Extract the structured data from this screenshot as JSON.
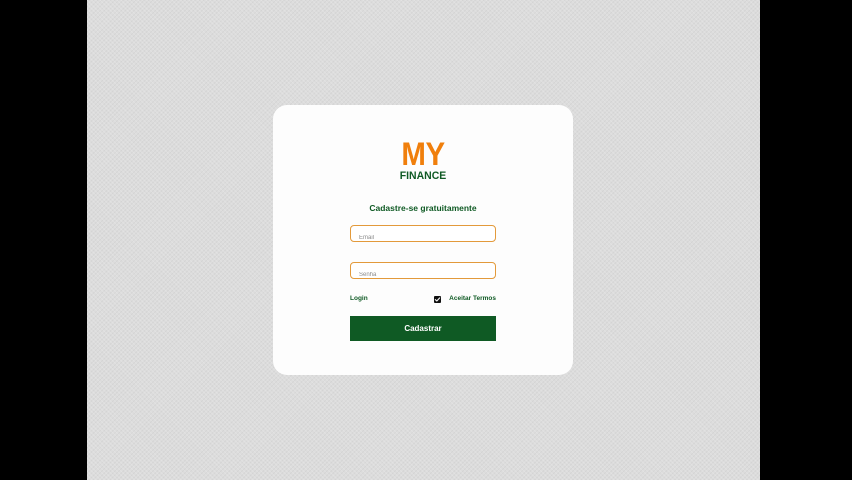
{
  "colors": {
    "background": "#dcdcdc",
    "card": "#fdfdfd",
    "brand_orange": "#f07f0c",
    "brand_green": "#0f5a24",
    "field_border": "#e39a3b"
  },
  "logo": {
    "top": "MY",
    "bottom": "FINANCE"
  },
  "form": {
    "subtitle": "Cadastre-se gratuitamente",
    "email": {
      "value": "",
      "placeholder": "Email"
    },
    "password": {
      "value": "",
      "placeholder": "Senha"
    },
    "login_link": "Login",
    "terms": {
      "label": "Aceitar Termos",
      "checked": true
    },
    "submit_label": "Cadastrar"
  },
  "icons": {
    "checkbox": "checkmark-icon"
  }
}
